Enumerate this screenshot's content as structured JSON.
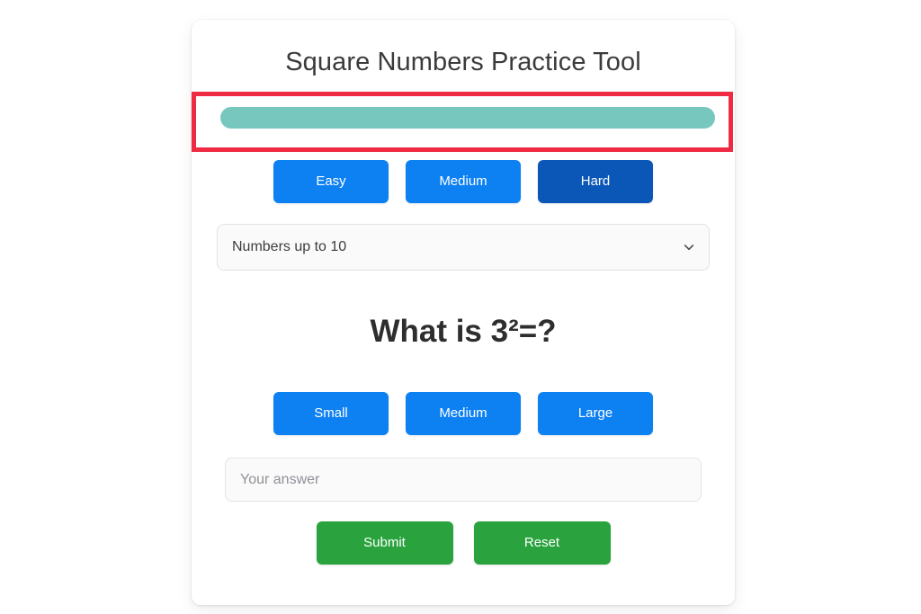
{
  "app": {
    "title": "Square Numbers Practice Tool",
    "card_background": "#ffffff",
    "page_background": "#ffffff"
  },
  "progress": {
    "highlight_border_color": "#ef2b43",
    "fill_color": "#78c7bf",
    "percent": 100,
    "label": ""
  },
  "difficulty": {
    "selected": "Hard",
    "options": [
      {
        "label": "Easy",
        "selected": false,
        "color": "#0d80f2"
      },
      {
        "label": "Medium",
        "selected": false,
        "color": "#0d80f2"
      },
      {
        "label": "Hard",
        "selected": true,
        "color": "#0b57b8"
      }
    ]
  },
  "range_select": {
    "value": "Numbers up to 10",
    "icon": "chevron-down-icon"
  },
  "question": {
    "text": "What is 3²=?"
  },
  "size": {
    "options": [
      {
        "label": "Small",
        "selected": false,
        "color": "#0d80f2"
      },
      {
        "label": "Medium",
        "selected": false,
        "color": "#0d80f2"
      },
      {
        "label": "Large",
        "selected": false,
        "color": "#0d80f2"
      }
    ]
  },
  "answer": {
    "value": "",
    "placeholder": "Your answer"
  },
  "actions": {
    "submit_label": "Submit",
    "reset_label": "Reset",
    "color": "#2aa33f"
  }
}
